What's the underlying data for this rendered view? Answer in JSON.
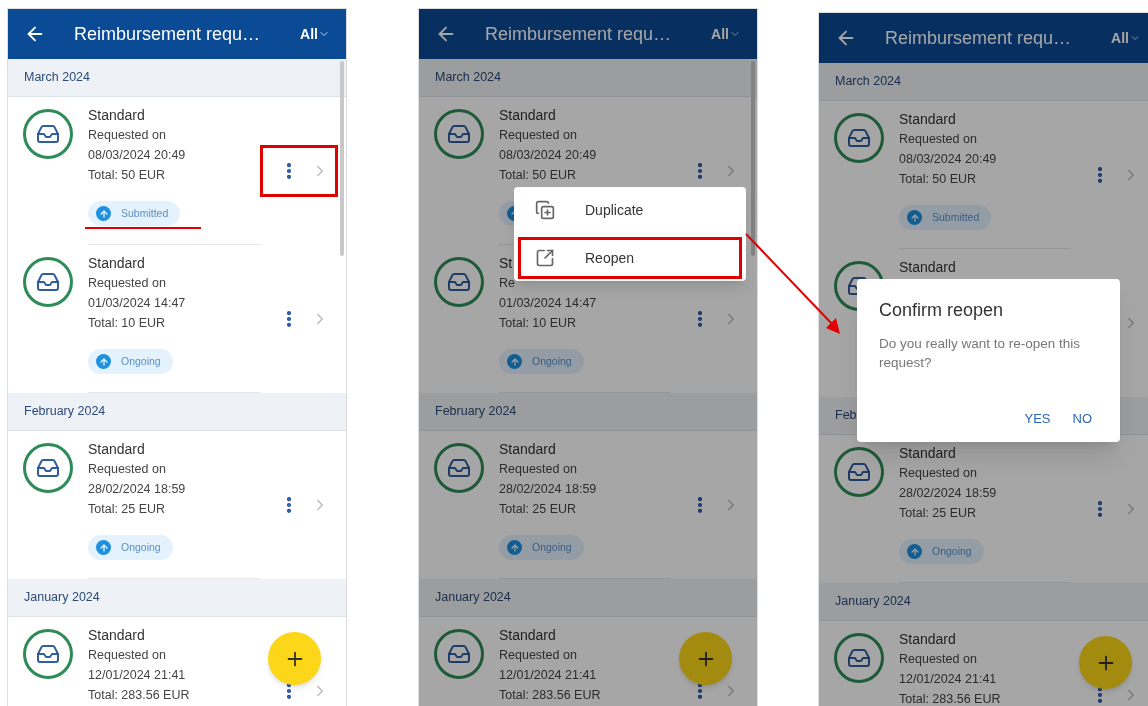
{
  "screens": [
    {
      "header": {
        "title": "Reimbursement requ…",
        "filter": "All"
      },
      "groups": [
        {
          "month": "March 2024",
          "requests": [
            {
              "type": "Standard",
              "requested_label": "Requested on",
              "date": "08/03/2024 20:49",
              "total": "Total: 50 EUR",
              "badge": true,
              "status": "Submitted",
              "annotated": true
            },
            {
              "type": "Standard",
              "requested_label": "Requested on",
              "date": "01/03/2024 14:47",
              "total": "Total: 10 EUR",
              "badge": true,
              "status": "Ongoing",
              "annotated": false
            }
          ]
        },
        {
          "month": "February 2024",
          "requests": [
            {
              "type": "Standard",
              "requested_label": "Requested on",
              "date": "28/02/2024 18:59",
              "total": "Total: 25 EUR",
              "badge": true,
              "status": "Ongoing",
              "annotated": false
            }
          ]
        },
        {
          "month": "January 2024",
          "requests": [
            {
              "type": "Standard",
              "requested_label": "Requested on",
              "date": "12/01/2024 21:41",
              "total": "Total: 283.56 EUR",
              "badge": false,
              "annotated": false
            }
          ]
        }
      ],
      "overlay": {
        "kind": "none"
      }
    },
    {
      "header": {
        "title": "Reimbursement requ…",
        "filter": "All"
      },
      "groups": [
        {
          "month": "March 2024",
          "requests": [
            {
              "type": "Standard",
              "requested_label": "Requested on",
              "date": "08/03/2024 20:49",
              "total": "Total: 50 EUR",
              "badge": true,
              "annotated": false
            },
            {
              "type": "St",
              "requested_label": "Re",
              "date": "01/03/2024 14:47",
              "total": "Total: 10 EUR",
              "badge": true,
              "status": "Ongoing",
              "annotated": false
            }
          ]
        },
        {
          "month": "February 2024",
          "requests": [
            {
              "type": "Standard",
              "requested_label": "Requested on",
              "date": "28/02/2024 18:59",
              "total": "Total: 25 EUR",
              "badge": true,
              "status": "Ongoing",
              "annotated": false
            }
          ]
        },
        {
          "month": "January 2024",
          "requests": [
            {
              "type": "Standard",
              "requested_label": "Requested on",
              "date": "12/01/2024 21:41",
              "total": "Total: 283.56 EUR",
              "badge": false,
              "annotated": false
            }
          ]
        }
      ],
      "overlay": {
        "kind": "menu",
        "items": [
          {
            "kind": "duplicate",
            "label": "Duplicate",
            "highlighted": false
          },
          {
            "kind": "reopen",
            "label": "Reopen",
            "highlighted": true
          }
        ]
      }
    },
    {
      "header": {
        "title": "Reimbursement requ…",
        "filter": "All"
      },
      "groups": [
        {
          "month": "March 2024",
          "requests": [
            {
              "type": "Standard",
              "requested_label": "Requested on",
              "date": "08/03/2024 20:49",
              "total": "Total: 50 EUR",
              "badge": true,
              "status": "Submitted",
              "annotated": false
            },
            {
              "type": "Standard",
              "badge": false,
              "annotated": false
            }
          ]
        },
        {
          "month": "Feb",
          "requests": [
            {
              "type": "Standard",
              "requested_label": "Requested on",
              "date": "28/02/2024 18:59",
              "total": "Total: 25 EUR",
              "badge": true,
              "status": "Ongoing",
              "annotated": false
            }
          ]
        },
        {
          "month": "January 2024",
          "requests": [
            {
              "type": "Standard",
              "requested_label": "Requested on",
              "date": "12/01/2024 21:41",
              "total": "Total: 283.56 EUR",
              "badge": false,
              "annotated": false
            }
          ]
        }
      ],
      "overlay": {
        "kind": "dialog",
        "title": "Confirm reopen",
        "message": "Do you really want to re-open this request?",
        "buttons": [
          "YES",
          "NO"
        ]
      }
    }
  ]
}
